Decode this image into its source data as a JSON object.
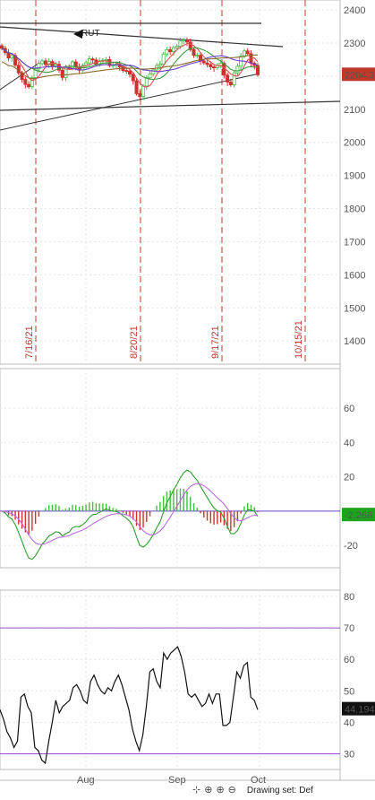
{
  "symbol": "RUT",
  "toolbar": {
    "icons": [
      "mouse-icon",
      "crosshair-icon",
      "zoom-in-icon",
      "zoom-out-icon"
    ],
    "status_text": "Drawing set: Def"
  },
  "colors": {
    "up_candle": "#3fbf3f",
    "down_candle": "#d0312d",
    "price_badge": "#c0392b",
    "macd_badge": "#1aa51a",
    "rsi_badge": "#111111",
    "rsi_bands": "#9a4bd1",
    "event_lines": "#c0392b",
    "ma_fast": "#e05050",
    "ma_mid": "#3a9a3a",
    "ma_slow": "#8a6a2a",
    "ma_purple": "#6b3fd1",
    "macd_line": "#2e9e2e",
    "signal_line": "#b96be0"
  },
  "chart_data": [
    {
      "type": "candlestick",
      "panel": "price",
      "symbol": "RUT",
      "ylim": [
        1330,
        2430
      ],
      "y_ticks": [
        1400,
        1500,
        1600,
        1700,
        1800,
        1900,
        2000,
        2100,
        2200,
        2300,
        2400
      ],
      "last_value_label": "2204.3",
      "event_lines": [
        "7/16/21",
        "8/20/21",
        "9/17/21",
        "10/15/21"
      ],
      "series": [
        {
          "name": "RUT",
          "ohlc_close": [
            2284,
            2271,
            2255,
            2262,
            2233,
            2210,
            2190,
            2175,
            2168,
            2195,
            2222,
            2238,
            2246,
            2235,
            2244,
            2231,
            2236,
            2218,
            2196,
            2226,
            2225,
            2243,
            2228,
            2218,
            2232,
            2240,
            2252,
            2249,
            2236,
            2246,
            2248,
            2250,
            2232,
            2234,
            2236,
            2228,
            2217,
            2215,
            2206,
            2186,
            2147,
            2138,
            2170,
            2195,
            2207,
            2219,
            2232,
            2236,
            2267,
            2280,
            2274,
            2286,
            2290,
            2306,
            2309,
            2303,
            2280,
            2263,
            2263,
            2246,
            2240,
            2235,
            2228,
            2225,
            2232,
            2239,
            2203,
            2182,
            2174,
            2210,
            2230,
            2260,
            2276,
            2268,
            2239,
            2232,
            2204
          ]
        }
      ],
      "grid": true
    },
    {
      "type": "histogram+line",
      "panel": "MACD",
      "ylim": [
        -33,
        83
      ],
      "y_ticks": [
        -20,
        20,
        40,
        60
      ],
      "last_value_label": "-2.268",
      "grid": true
    },
    {
      "type": "line",
      "panel": "RSI",
      "ylim": [
        25,
        82
      ],
      "y_ticks": [
        30,
        40,
        50,
        60,
        70,
        80
      ],
      "bands": [
        30,
        70
      ],
      "last_value_label": "44.194",
      "series": [
        {
          "values": [
            44,
            41,
            37,
            35,
            32,
            34,
            48,
            49,
            45,
            43,
            32,
            31,
            28,
            27,
            34,
            40,
            47,
            43,
            45,
            46,
            47,
            51,
            52,
            50,
            47,
            46,
            53,
            55,
            52,
            50,
            49,
            51,
            50,
            53,
            55,
            52,
            48,
            44,
            38,
            34,
            31,
            36,
            45,
            56,
            57,
            53,
            51,
            62,
            60,
            62,
            63,
            64,
            61,
            56,
            49,
            48,
            49,
            47,
            45,
            46,
            49,
            46,
            49,
            49,
            39,
            39,
            40,
            48,
            56,
            54,
            58,
            59,
            48,
            47,
            44
          ]
        }
      ],
      "grid": true
    }
  ],
  "x_axis": {
    "ticks": [
      "Aug",
      "Sep",
      "Oct"
    ]
  }
}
